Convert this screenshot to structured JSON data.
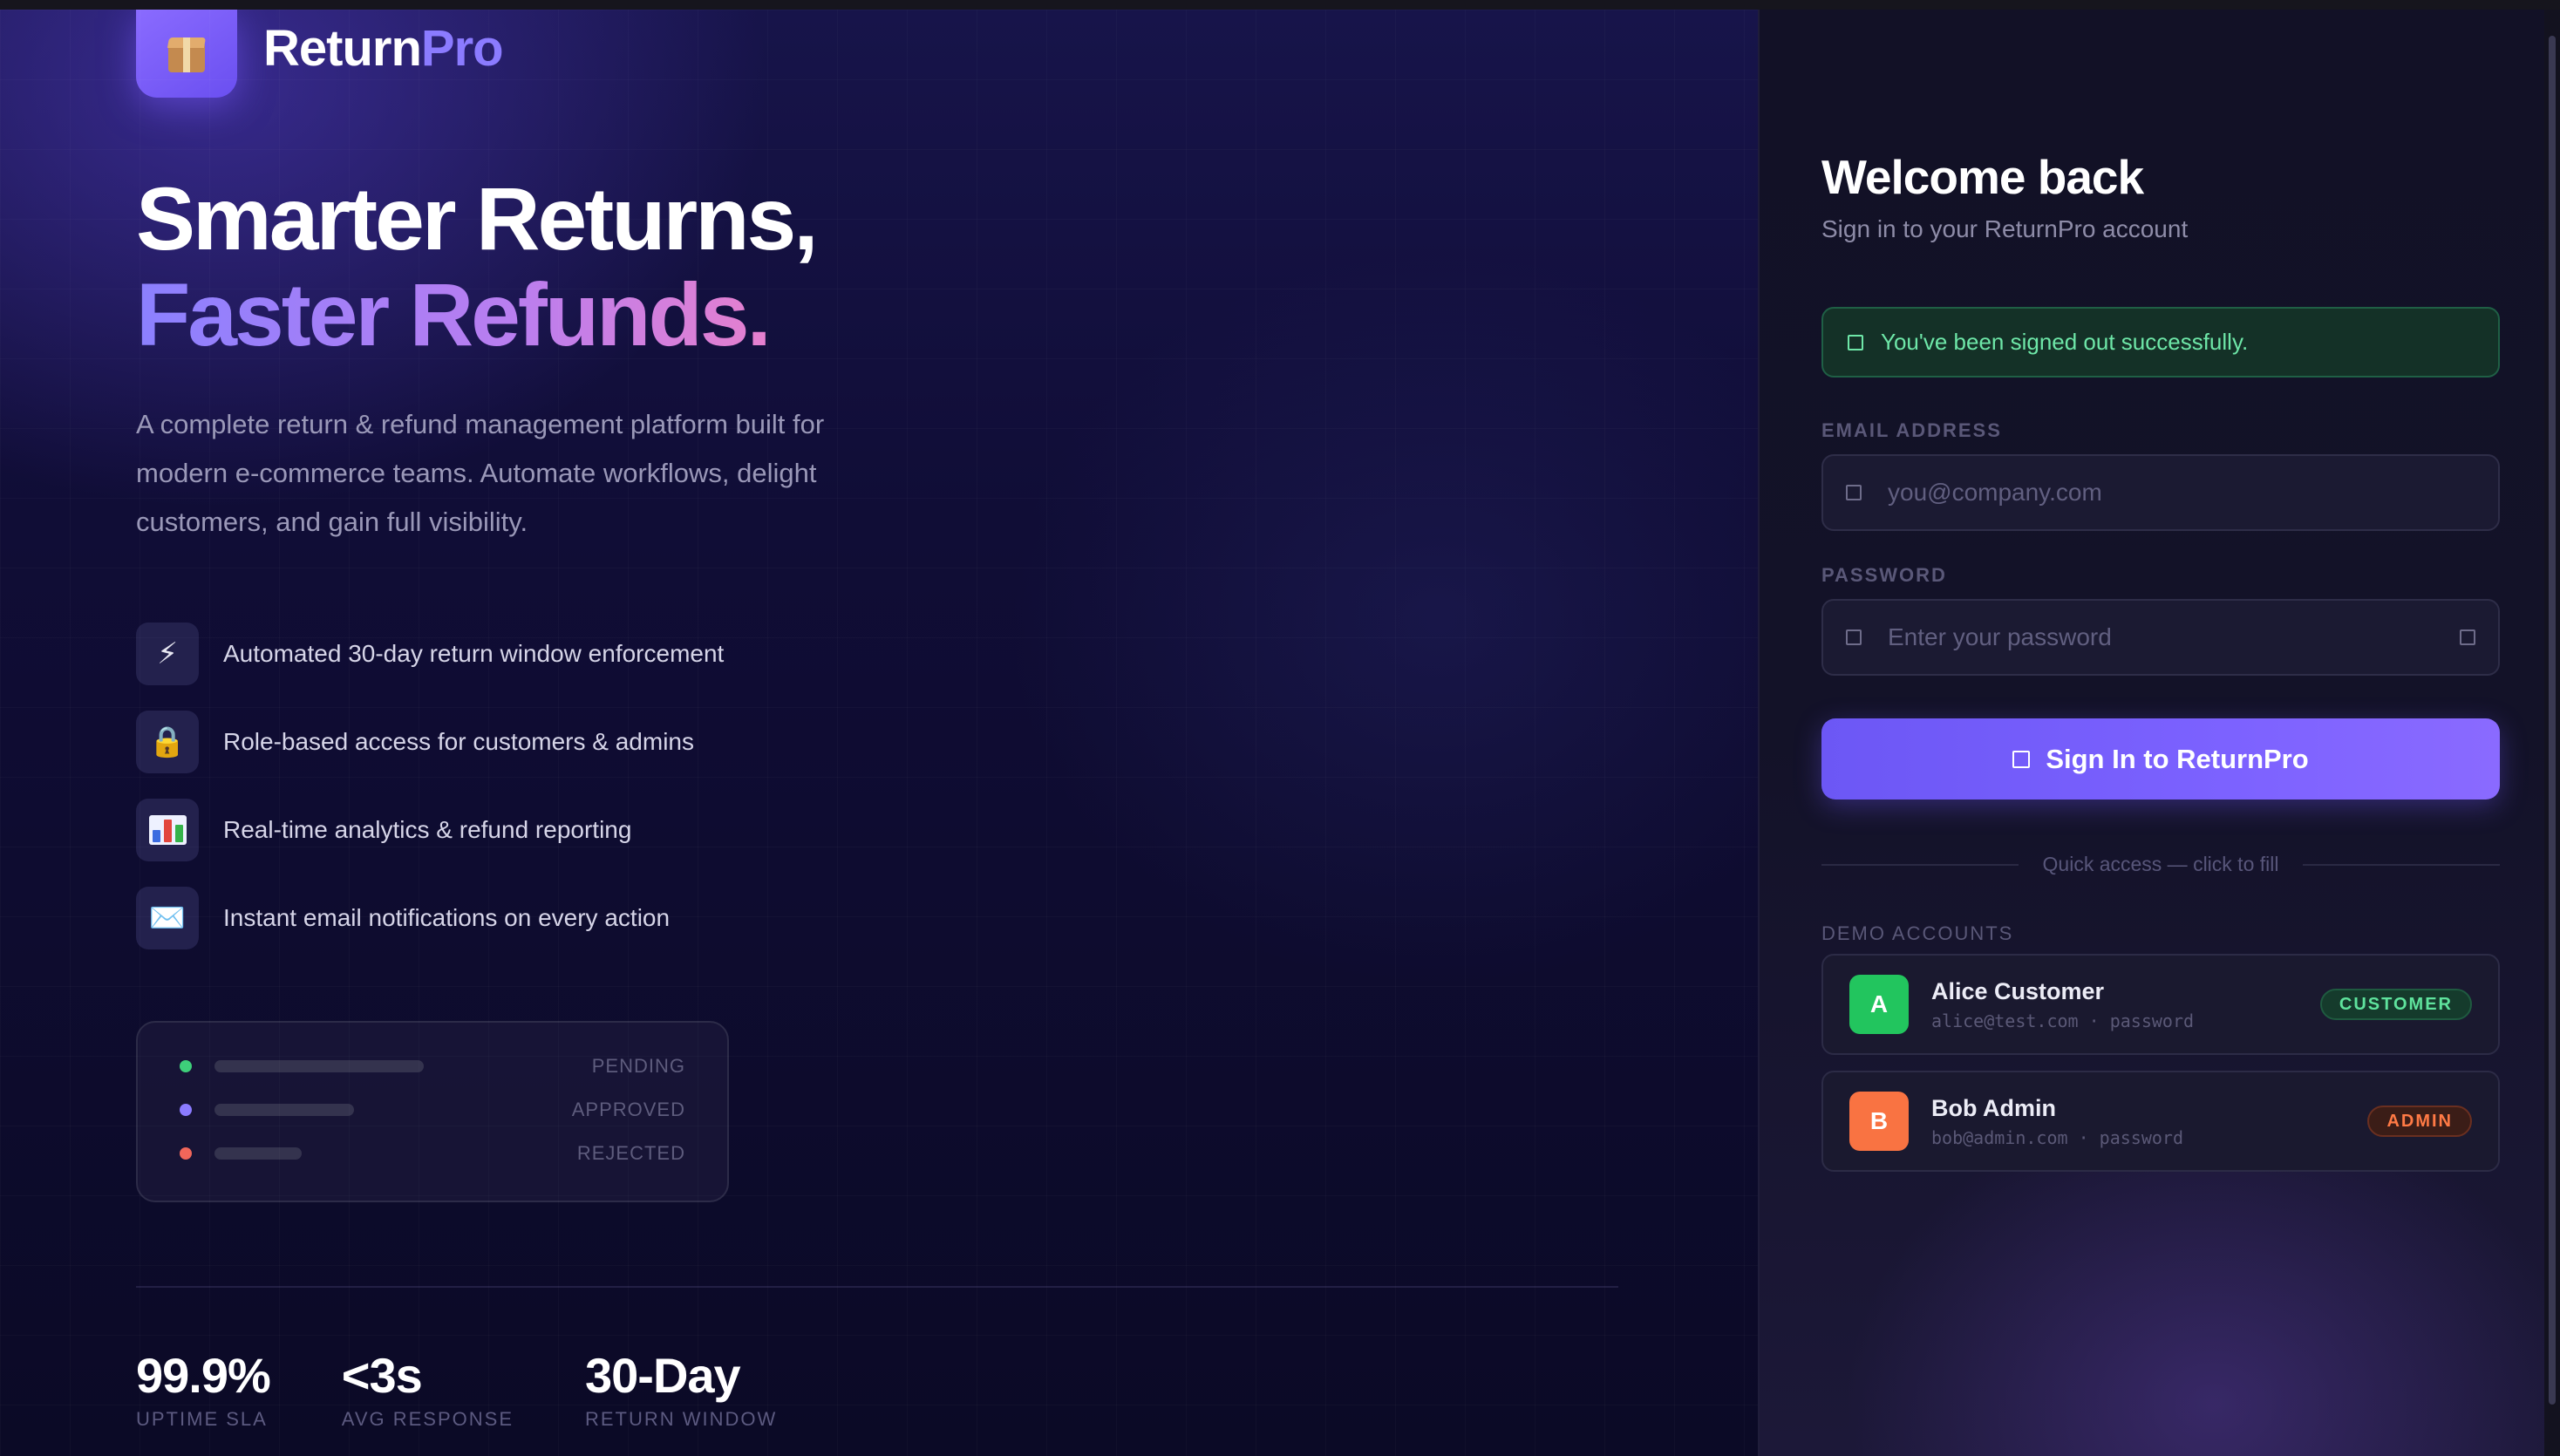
{
  "brand": {
    "name_main": "Return",
    "name_accent": "Pro"
  },
  "hero": {
    "line1": "Smarter Returns,",
    "line2": "Faster Refunds.",
    "description": "A complete return & refund management platform built for modern e-commerce teams. Automate workflows, delight customers, and gain full visibility."
  },
  "features": [
    {
      "icon": "lightning-icon",
      "glyph": "⚡",
      "label": "Automated 30-day return window enforcement"
    },
    {
      "icon": "lock-icon",
      "glyph": "🔒",
      "label": "Role-based access for customers & admins"
    },
    {
      "icon": "bar-chart-icon",
      "glyph": "",
      "label": "Real-time analytics & refund reporting"
    },
    {
      "icon": "envelope-icon",
      "glyph": "✉️",
      "label": "Instant email notifications on every action"
    }
  ],
  "status_card": {
    "rows": [
      {
        "label": "PENDING",
        "color": "#3ecf7a"
      },
      {
        "label": "APPROVED",
        "color": "#8b7bff"
      },
      {
        "label": "REJECTED",
        "color": "#f0665a"
      }
    ]
  },
  "stats": [
    {
      "value": "99.9%",
      "label": "UPTIME SLA"
    },
    {
      "value": "<3s",
      "label": "AVG RESPONSE"
    },
    {
      "value": "30-Day",
      "label": "RETURN WINDOW"
    }
  ],
  "login": {
    "title": "Welcome back",
    "subtitle": "Sign in to your ReturnPro account",
    "alert": "You've been signed out successfully.",
    "email_label": "EMAIL ADDRESS",
    "email_placeholder": "you@company.com",
    "email_value": "",
    "password_label": "PASSWORD",
    "password_placeholder": "Enter your password",
    "password_value": "",
    "submit_label": "Sign In to ReturnPro",
    "quick_access": "Quick access — click to fill",
    "demo_heading": "DEMO ACCOUNTS",
    "accounts": [
      {
        "initial": "A",
        "name": "Alice Customer",
        "email": "alice@test.com",
        "password": "password",
        "role": "CUSTOMER",
        "avatar_color": "#22c55e"
      },
      {
        "initial": "B",
        "name": "Bob Admin",
        "email": "bob@admin.com",
        "password": "password",
        "role": "ADMIN",
        "avatar_color": "#f97342"
      }
    ]
  },
  "colors": {
    "accent": "#7c62ff",
    "success": "#6ee7a8",
    "background": "#0b0a24"
  }
}
